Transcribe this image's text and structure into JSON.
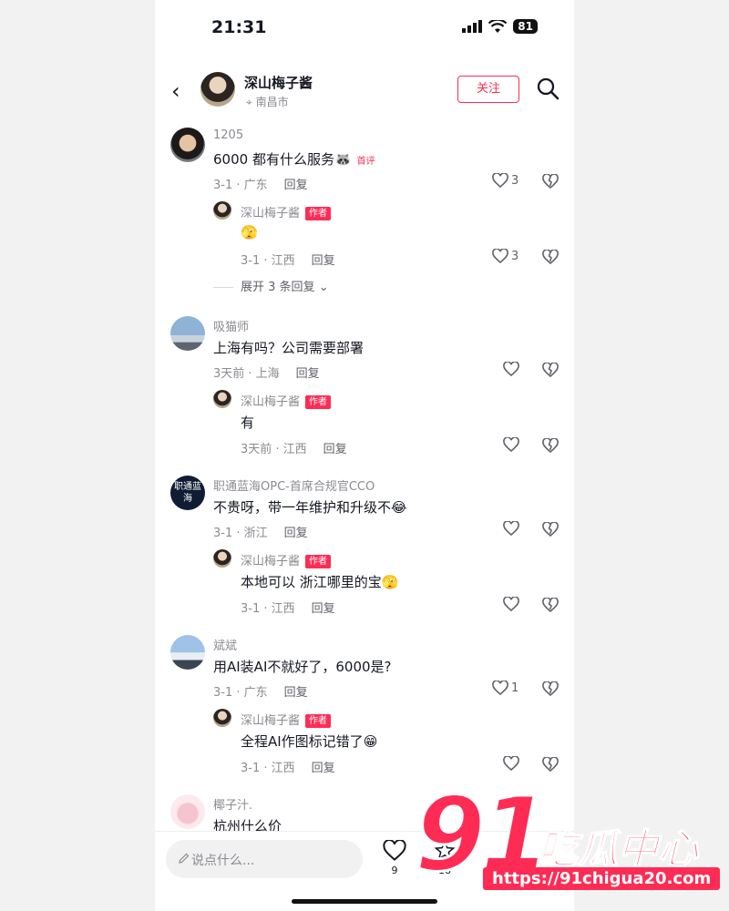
{
  "status": {
    "time": "21:31",
    "battery": "81"
  },
  "header": {
    "back_icon": "chevron-left-icon",
    "name": "深山梅子酱",
    "location": "南昌市",
    "follow": "关注",
    "search_icon": "search-icon"
  },
  "comments": [
    {
      "user": "1205",
      "text": "6000 都有什么服务",
      "emoji": "🦝",
      "tag": "首评",
      "meta": "3-1 · 广东",
      "reply": "回复",
      "likes": "3",
      "sub": {
        "user": "深山梅子酱",
        "tag": "作者",
        "text": "",
        "emoji": "🫣",
        "meta": "3-1 · 江西",
        "reply": "回复",
        "likes": "3"
      },
      "expand": "展开 3 条回复"
    },
    {
      "user": "吸猫师",
      "text": "上海有吗？公司需要部署",
      "meta": "3天前 · 上海",
      "reply": "回复",
      "likes": "",
      "sub": {
        "user": "深山梅子酱",
        "tag": "作者",
        "text": "有",
        "emoji": "",
        "meta": "3天前 · 江西",
        "reply": "回复",
        "likes": ""
      }
    },
    {
      "user": "职通蓝海OPC-首席合规官CCO",
      "text": "不贵呀，带一年维护和升级不",
      "emoji": "😂",
      "avatar_text": "职通蓝海",
      "meta": "3-1 · 浙江",
      "reply": "回复",
      "likes": "",
      "sub": {
        "user": "深山梅子酱",
        "tag": "作者",
        "text": "本地可以 浙江哪里的宝",
        "emoji": "🫣",
        "meta": "3-1 · 江西",
        "reply": "回复",
        "likes": ""
      }
    },
    {
      "user": "斌斌",
      "text": "用AI装AI不就好了，6000是?",
      "meta": "3-1 · 广东",
      "reply": "回复",
      "likes": "1",
      "sub": {
        "user": "深山梅子酱",
        "tag": "作者",
        "text": "全程AI作图标记错了",
        "emoji": "😁",
        "meta": "3-1 · 江西",
        "reply": "回复",
        "likes": ""
      }
    },
    {
      "user": "椰子汁.",
      "text": "杭州什么价"
    }
  ],
  "bottom": {
    "placeholder": "说点什么...",
    "likes": "9",
    "stars": "18"
  },
  "watermark": {
    "number": "91",
    "name": "吃瓜中心",
    "url": "https://91chigua20.com"
  },
  "colors": {
    "accent": "#fe2c55",
    "text": "#161823",
    "muted": "#8a8b91"
  }
}
